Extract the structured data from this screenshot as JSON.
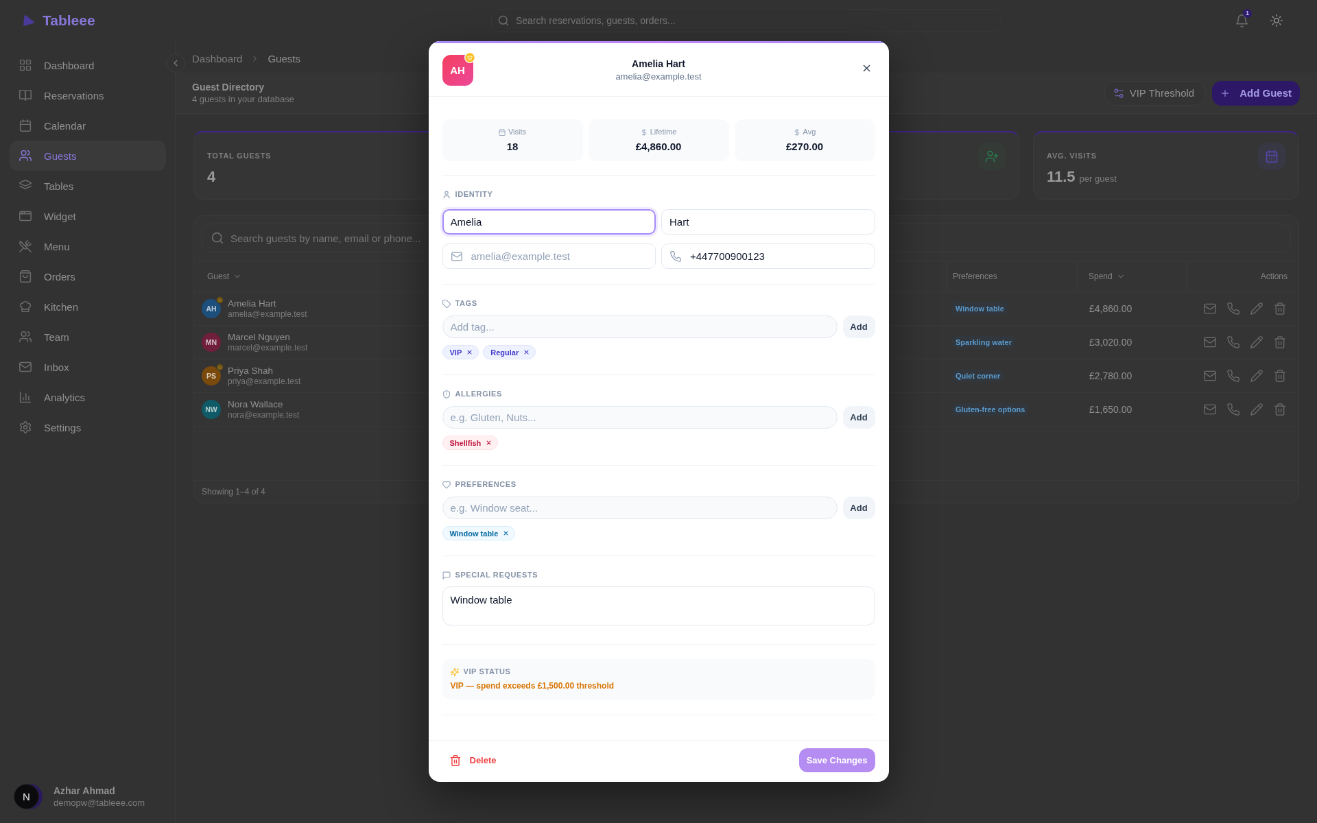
{
  "app": {
    "name": "Tableee",
    "search": {
      "placeholder": "Search reservations, guests, orders..."
    },
    "notifications": {
      "count": "1"
    }
  },
  "sidebar": {
    "items": [
      {
        "label": "Dashboard",
        "selected": false
      },
      {
        "label": "Reservations",
        "selected": false
      },
      {
        "label": "Calendar",
        "selected": false
      },
      {
        "label": "Guests",
        "selected": true
      },
      {
        "label": "Tables",
        "selected": false
      },
      {
        "label": "Widget",
        "selected": false
      },
      {
        "label": "Menu",
        "selected": false
      },
      {
        "label": "Orders",
        "selected": false
      },
      {
        "label": "Kitchen",
        "selected": false
      },
      {
        "label": "Team",
        "selected": false
      },
      {
        "label": "Inbox",
        "selected": false
      },
      {
        "label": "Analytics",
        "selected": false
      },
      {
        "label": "Settings",
        "selected": false
      }
    ],
    "user": {
      "initial": "N",
      "name": "Azhar Ahmad",
      "email": "demopw@tableee.com"
    }
  },
  "breadcrumb": [
    "Dashboard",
    "Guests"
  ],
  "page_header": {
    "title": "Guest Directory",
    "subtitle": "4 guests in your database",
    "buttons": [
      {
        "label": "VIP Threshold",
        "kind": "outline"
      },
      {
        "label": "Add Guest",
        "kind": "primary"
      }
    ]
  },
  "stat_cards": [
    {
      "label": "TOTAL GUESTS",
      "value": "4"
    },
    {
      "label": "AVG. VISITS",
      "value": "11.5",
      "unit": "per guest"
    }
  ],
  "guest_table": {
    "search": {
      "placeholder": "Search guests by name, email or phone..."
    },
    "columns": [
      {
        "label": "Guest",
        "sortable": true
      },
      {
        "label": "Preferences",
        "sortable": false
      },
      {
        "label": "Spend",
        "sortable": true
      },
      {
        "label": "Actions",
        "sortable": false
      }
    ],
    "rows": [
      {
        "initials": "AH",
        "color": "#1d4f7c",
        "vip": true,
        "name": "Amelia Hart",
        "email": "amelia@example.test",
        "preference": "Window table",
        "spend": "£4,860.00"
      },
      {
        "initials": "MN",
        "color": "#6f1f3b",
        "vip": false,
        "name": "Marcel Nguyen",
        "email": "marcel@example.test",
        "preference": "Sparkling water",
        "spend": "£3,020.00"
      },
      {
        "initials": "PS",
        "color": "#7a4a0c",
        "vip": true,
        "name": "Priya Shah",
        "email": "priya@example.test",
        "preference": "Quiet corner",
        "spend": "£2,780.00"
      },
      {
        "initials": "NW",
        "color": "#0f5a67",
        "vip": false,
        "name": "Nora Wallace",
        "email": "nora@example.test",
        "preference": "Gluten-free options",
        "spend": "£1,650.00"
      }
    ],
    "footer": "Showing 1–4 of 4"
  },
  "guest_dialog": {
    "avatar": {
      "initials": "AH",
      "vip": true
    },
    "name": "Amelia Hart",
    "email": "amelia@example.test",
    "stats": [
      {
        "label": "Visits",
        "value": "18"
      },
      {
        "label": "Lifetime",
        "value": "£4,860.00"
      },
      {
        "label": "Avg",
        "value": "£270.00"
      }
    ],
    "identity": {
      "title": "IDENTITY",
      "fields": [
        {
          "kind": "text",
          "value": "Amelia",
          "focused": true
        },
        {
          "kind": "text",
          "value": "Hart",
          "focused": false
        },
        {
          "kind": "email",
          "placeholder": "amelia@example.test",
          "focused": false
        },
        {
          "kind": "phone",
          "value": "+447700900123",
          "focused": false
        }
      ]
    },
    "tags": {
      "title": "TAGS",
      "input": {
        "placeholder": "Add tag..."
      },
      "button": "Add",
      "chips": [
        "VIP",
        "Regular"
      ]
    },
    "allergies": {
      "title": "ALLERGIES",
      "input": {
        "placeholder": "e.g. Gluten, Nuts..."
      },
      "button": "Add",
      "chips": [
        "Shellfish"
      ]
    },
    "preferences": {
      "title": "PREFERENCES",
      "input": {
        "placeholder": "e.g. Window seat..."
      },
      "button": "Add",
      "chips": [
        "Window table"
      ]
    },
    "special_requests": {
      "title": "SPECIAL REQUESTS",
      "value": "Window table"
    },
    "vip_status": {
      "title": "VIP STATUS",
      "message": "VIP — spend exceeds £1,500.00 threshold"
    },
    "footer": {
      "delete": "Delete",
      "save": {
        "label": "Save Changes",
        "disabled": true
      }
    }
  }
}
